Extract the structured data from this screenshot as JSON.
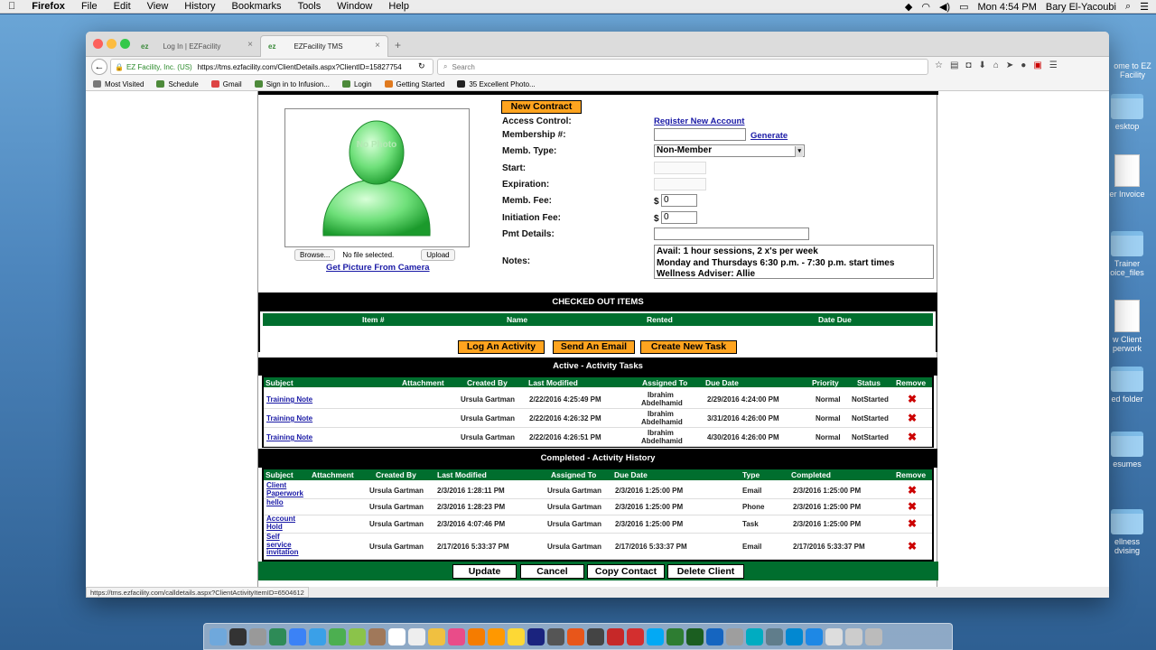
{
  "menubar": {
    "items": [
      "Firefox",
      "File",
      "Edit",
      "View",
      "History",
      "Bookmarks",
      "Tools",
      "Window",
      "Help"
    ],
    "clock": "Mon 4:54 PM",
    "user": "Bary El-Yacoubi"
  },
  "browser": {
    "tabs": [
      {
        "label": "Log In | EZFacility"
      },
      {
        "label": "EZFacility TMS"
      }
    ],
    "url_identity": "EZ Facility, Inc. (US)",
    "url": "https://tms.ezfacility.com/ClientDetails.aspx?ClientID=15827754",
    "search_placeholder": "Search",
    "bookmarks": [
      "Most Visited",
      "Schedule",
      "Gmail",
      "Sign in to Infusion...",
      "Login",
      "Getting Started",
      "35 Excellent Photo..."
    ],
    "status_url": "https://tms.ezfacility.com/calldetails.aspx?ClientActivityItemID=6504612"
  },
  "desktop_icons": [
    "ome to EZ Facility",
    "esktop",
    "er Invoice",
    "Trainer oice_files",
    "w Client perwork",
    "ed folder",
    "esumes",
    "ellness dvising"
  ],
  "photo": {
    "no_photo": "No Photo",
    "browse": "Browse...",
    "no_file": "No file selected.",
    "upload": "Upload",
    "camera_link": "Get Picture From Camera"
  },
  "membership": {
    "new_contract": "New Contract",
    "access_control": "Access Control:",
    "register_link": "Register New Account",
    "membership_no": "Membership #:",
    "generate": "Generate",
    "memb_type": "Memb. Type:",
    "memb_type_value": "Non-Member",
    "start": "Start:",
    "expiration": "Expiration:",
    "memb_fee": "Memb. Fee:",
    "memb_fee_value": "0",
    "initiation_fee": "Initiation Fee:",
    "initiation_fee_value": "0",
    "currency": "$",
    "pmt_details": "Pmt Details:",
    "notes": "Notes:",
    "notes_lines": [
      "Avail: 1 hour sessions, 2 x's per week",
      "Monday and Thursdays 6:30 p.m. - 7:30 p.m. start times",
      "Wellness Adviser: Allie"
    ]
  },
  "checked_out": {
    "title": "CHECKED OUT ITEMS",
    "columns": [
      "Item #",
      "Name",
      "Rented",
      "Date Due"
    ]
  },
  "actions": {
    "log_activity": "Log An Activity",
    "send_email": "Send An Email",
    "create_task": "Create New Task"
  },
  "active_tasks": {
    "title": "Active - Activity Tasks",
    "columns": [
      "Subject",
      "Attachment",
      "Created By",
      "Last Modified",
      "Assigned To",
      "Due Date",
      "Priority",
      "Status",
      "Remove"
    ],
    "rows": [
      {
        "subject": "Training Note",
        "created_by": "Ursula Gartman",
        "modified": "2/22/2016 4:25:49 PM",
        "assigned1": "Ibrahim",
        "assigned2": "Abdelhamid",
        "due": "2/29/2016 4:24:00 PM",
        "priority": "Normal",
        "status": "NotStarted",
        "remove": "✖"
      },
      {
        "subject": "Training Note",
        "created_by": "Ursula Gartman",
        "modified": "2/22/2016 4:26:32 PM",
        "assigned1": "Ibrahim",
        "assigned2": "Abdelhamid",
        "due": "3/31/2016 4:26:00 PM",
        "priority": "Normal",
        "status": "NotStarted",
        "remove": "✖"
      },
      {
        "subject": "Training Note",
        "created_by": "Ursula Gartman",
        "modified": "2/22/2016 4:26:51 PM",
        "assigned1": "Ibrahim",
        "assigned2": "Abdelhamid",
        "due": "4/30/2016 4:26:00 PM",
        "priority": "Normal",
        "status": "NotStarted",
        "remove": "✖"
      }
    ]
  },
  "history": {
    "title": "Completed - Activity History",
    "columns": [
      "Subject",
      "Attachment",
      "Created By",
      "Last Modified",
      "Assigned To",
      "Due Date",
      "Type",
      "Completed",
      "Remove"
    ],
    "rows": [
      {
        "subject1": "Client",
        "subject2": "Paperwork",
        "subject3": "",
        "created_by": "Ursula Gartman",
        "modified": "2/3/2016 1:28:11 PM",
        "assigned": "Ursula Gartman",
        "due": "2/3/2016 1:25:00 PM",
        "type": "Email",
        "completed": "2/3/2016 1:25:00 PM",
        "remove": "✖"
      },
      {
        "subject1": "hello",
        "subject2": "",
        "subject3": "",
        "created_by": "Ursula Gartman",
        "modified": "2/3/2016 1:28:23 PM",
        "assigned": "Ursula Gartman",
        "due": "2/3/2016 1:25:00 PM",
        "type": "Phone",
        "completed": "2/3/2016 1:25:00 PM",
        "remove": "✖"
      },
      {
        "subject1": "Account",
        "subject2": "Hold",
        "subject3": "",
        "created_by": "Ursula Gartman",
        "modified": "2/3/2016 4:07:46 PM",
        "assigned": "Ursula Gartman",
        "due": "2/3/2016 1:25:00 PM",
        "type": "Task",
        "completed": "2/3/2016 1:25:00 PM",
        "remove": "✖"
      },
      {
        "subject1": "Self",
        "subject2": "service",
        "subject3": "invitation",
        "created_by": "Ursula Gartman",
        "modified": "2/17/2016 5:33:37 PM",
        "assigned": "Ursula Gartman",
        "due": "2/17/2016 5:33:37 PM",
        "type": "Email",
        "completed": "2/17/2016 5:33:37 PM",
        "remove": "✖"
      }
    ]
  },
  "bottom": {
    "update": "Update",
    "cancel": "Cancel",
    "copy": "Copy Contact",
    "delete": "Delete Client"
  },
  "colors": {
    "accent_orange": "#ffa41f",
    "grid_green": "#006e2e",
    "remove_red": "#cc0000",
    "link_blue": "#1a1aa6"
  }
}
